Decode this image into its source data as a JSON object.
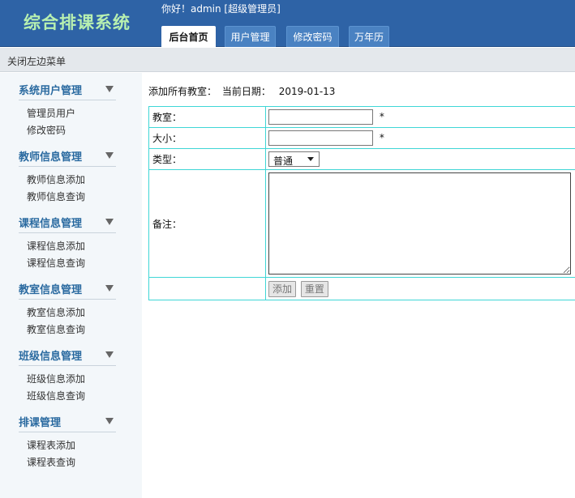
{
  "header": {
    "app_title": "综合排课系统",
    "greeting": "你好！admin [超级管理员]",
    "tabs": [
      {
        "label": "后台首页",
        "active": true
      },
      {
        "label": "用户管理",
        "active": false
      },
      {
        "label": "修改密码",
        "active": false
      },
      {
        "label": "万年历",
        "active": false
      }
    ]
  },
  "menubar": {
    "toggle_label": "关闭左边菜单"
  },
  "sidebar": {
    "groups": [
      {
        "title": "系统用户管理",
        "items": [
          "管理员用户",
          "修改密码"
        ]
      },
      {
        "title": "教师信息管理",
        "items": [
          "教师信息添加",
          "教师信息查询"
        ]
      },
      {
        "title": "课程信息管理",
        "items": [
          "课程信息添加",
          "课程信息查询"
        ]
      },
      {
        "title": "教室信息管理",
        "items": [
          "教室信息添加",
          "教室信息查询"
        ]
      },
      {
        "title": "班级信息管理",
        "items": [
          "班级信息添加",
          "班级信息查询"
        ]
      },
      {
        "title": "排课管理",
        "items": [
          "课程表添加",
          "课程表查询"
        ]
      }
    ]
  },
  "main": {
    "info_prefix": "添加所有教室：",
    "date_label": "当前日期：",
    "date_value": "2019-01-13",
    "form": {
      "classroom_label": "教室：",
      "classroom_value": "",
      "size_label": "大小：",
      "size_value": "",
      "required_mark": "*",
      "type_label": "类型：",
      "type_selected": "普通",
      "remark_label": "备注：",
      "remark_value": "",
      "add_button": "添加",
      "reset_button": "重置"
    }
  },
  "colors": {
    "header_bg": "#2e63a6",
    "title_green": "#b8f0b0",
    "sidebar_bg": "#f3f7fa",
    "group_title": "#2a6aa0",
    "table_border": "#3fd6d6"
  }
}
